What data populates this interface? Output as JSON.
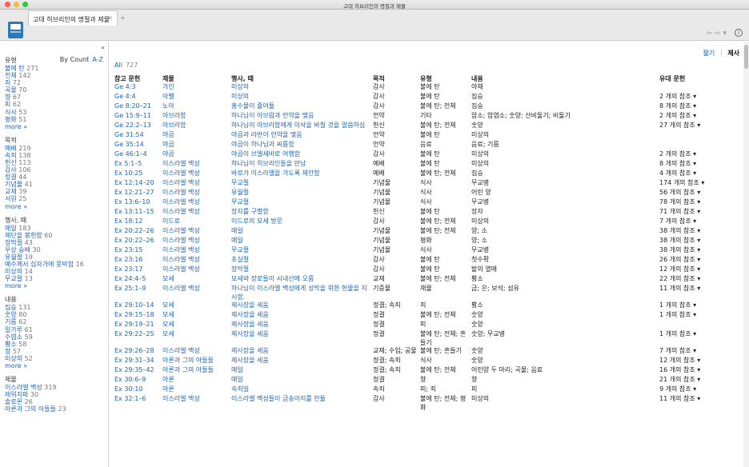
{
  "window": {
    "title": "고대 히브리인의 명절과 제물"
  },
  "tab": {
    "label": "고대 히브리인의 명절과 제물",
    "close": "×",
    "add": "+"
  },
  "toolbar": {
    "arrows": "⇦ ⇨ ▾",
    "help": "i"
  },
  "sidebar": {
    "collapse": "«",
    "sections": [
      {
        "title": "유형",
        "sort_by_count": "By Count",
        "sort_az": "A-Z",
        "items": [
          [
            "불에 탄",
            "271"
          ],
          [
            "전체",
            "142"
          ],
          [
            "죄",
            "72"
          ],
          [
            "곡물",
            "70"
          ],
          [
            "향",
            "67"
          ],
          [
            "피",
            "62"
          ],
          [
            "식사",
            "53"
          ],
          [
            "평화",
            "51"
          ]
        ],
        "more": "more »"
      },
      {
        "title": "목적",
        "items": [
          [
            "예배",
            "219"
          ],
          [
            "속죄",
            "138"
          ],
          [
            "헌신",
            "113"
          ],
          [
            "감사",
            "106"
          ],
          [
            "정결",
            "44"
          ],
          [
            "기념물",
            "41"
          ],
          [
            "교제",
            "39"
          ],
          [
            "서원",
            "25"
          ]
        ],
        "more": "more »"
      },
      {
        "title": "행사, 때",
        "items": [
          [
            "매일",
            "183"
          ],
          [
            "제단을 봉헌함",
            "60"
          ],
          [
            "장막절",
            "43"
          ],
          [
            "우상 숭배",
            "30"
          ],
          [
            "유월절",
            "19"
          ],
          [
            "예수께서 십자가에 못박힘",
            "16"
          ],
          [
            "미상의",
            "14"
          ],
          [
            "무교절",
            "13"
          ]
        ],
        "more": "more »"
      },
      {
        "title": "내용",
        "items": [
          [
            "짐승",
            "131"
          ],
          [
            "숫양",
            "80"
          ],
          [
            "기름",
            "62"
          ],
          [
            "밀가루",
            "61"
          ],
          [
            "수염소",
            "59"
          ],
          [
            "황소",
            "58"
          ],
          [
            "향",
            "57"
          ],
          [
            "미상의",
            "52"
          ]
        ],
        "more": "more »"
      },
      {
        "title": "제물",
        "items": [
          [
            "이스라엘 백성",
            "319"
          ],
          [
            "레위지파",
            "30"
          ],
          [
            "솔로몬",
            "26"
          ],
          [
            "아론과 그의 아들들",
            "23"
          ]
        ]
      }
    ]
  },
  "main": {
    "view_brief": "짧기",
    "view_offering": "제사",
    "all_label": "All",
    "all_count": "727",
    "headers": [
      "참고 문헌",
      "제물",
      "행사, 때",
      "목적",
      "유형",
      "내용",
      "유대 문헌"
    ],
    "rows": [
      [
        "Ge 4:3",
        "가인",
        "미상의",
        "감사",
        "불에 탄",
        "야채",
        ""
      ],
      [
        "Ge 4:4",
        "아벨",
        "미상의",
        "감사",
        "불에 탄",
        "짐승",
        "2 개의 참조 ▾"
      ],
      [
        "Ge 8:20–21",
        "노아",
        "홍수물이 줄어듦",
        "감사",
        "불에 탄; 전체",
        "짐승",
        "8 개의 참조 ▾"
      ],
      [
        "Ge 15:9–11",
        "아브라함",
        "하나님이 아브람과 언약을 맺음",
        "언약",
        "기타",
        "암소; 암염소; 숫양; 산비둘기; 비둘기",
        "2 개의 참조 ▾"
      ],
      [
        "Ge 22:2–13",
        "아브라함",
        "하나님이 아브라함에게 이삭을 바칠 것을 말씀하심",
        "헌신",
        "불에 탄; 전체",
        "숫양",
        "27 개의 참조 ▾"
      ],
      [
        "Ge 31:54",
        "야곱",
        "야곱과 라반이 언약을 맺음",
        "언약",
        "불에 탄",
        "미상의",
        ""
      ],
      [
        "Ge 35:14",
        "야곱",
        "야곱이 하나님과 씨름함",
        "언약",
        "음료",
        "음료; 기름",
        ""
      ],
      [
        "Ge 46:1–4",
        "야곱",
        "야곱이 브엘세바로 여행함",
        "감사",
        "불에 탄",
        "미상의",
        "2 개의 참조 ▾"
      ],
      [
        "Ex 5:1–5",
        "이스라엘 백성",
        "하나님이 히브리인들을 만남",
        "예배",
        "불에 탄",
        "미상의",
        "8 개의 참조 ▾"
      ],
      [
        "Ex 10:25",
        "이스라엘 백성",
        "바로가 이스라엘을 가도록 제안함",
        "예배",
        "불에 탄; 전체",
        "짐승",
        "4 개의 참조 ▾"
      ],
      [
        "Ex 12:14–20",
        "이스라엘 백성",
        "무교절",
        "기념물",
        "식사",
        "무교병",
        "174 개의 참조 ▾"
      ],
      [
        "Ex 12:21–27",
        "이스라엘 백성",
        "유월절",
        "기념물",
        "식사",
        "어린 양",
        "56 개의 참조 ▾"
      ],
      [
        "Ex 13:6–10",
        "이스라엘 백성",
        "무교절",
        "기념물",
        "식사",
        "무교병",
        "78 개의 참조 ▾"
      ],
      [
        "Ex 13:11–15",
        "이스라엘 백성",
        "장자를 구별함",
        "헌신",
        "불에 탄",
        "장자",
        "71 개의 참조 ▾"
      ],
      [
        "Ex 18:12",
        "이드로",
        "이드로의 모세 방문",
        "감사",
        "불에 탄; 전체",
        "미상의",
        "7 개의 참조 ▾"
      ],
      [
        "Ex 20:22–26",
        "이스라엘 백성",
        "매일",
        "기념물",
        "불에 탄; 전체",
        "양; 소",
        "38 개의 참조 ▾"
      ],
      [
        "Ex 20:22–26",
        "이스라엘 백성",
        "매일",
        "기념물",
        "평화",
        "양; 소",
        "38 개의 참조 ▾"
      ],
      [
        "Ex 23:15",
        "이스라엘 백성",
        "무교절",
        "기념물",
        "식사",
        "무교병",
        "38 개의 참조 ▾"
      ],
      [
        "Ex 23:16",
        "이스라엘 백성",
        "초실절",
        "감사",
        "불에 탄",
        "첫수확",
        "26 개의 참조 ▾"
      ],
      [
        "Ex 23:17",
        "이스라엘 백성",
        "장막절",
        "감사",
        "불에 탄",
        "밭의 열매",
        "12 개의 참조 ▾"
      ],
      [
        "Ex 24:4–5",
        "모세",
        "모세와 장로들이 시내산에 오름",
        "교제",
        "불에 탄; 전체",
        "황소",
        "22 개의 참조 ▾"
      ],
      [
        "Ex 25:1–9",
        "이스라엘 백성",
        "하나님이 이스라엘 백성에게 성막을 위한 헌물을 지시함.",
        "기증물",
        "재물",
        "금; 은; 보석; 섬유",
        "11 개의 참조 ▾"
      ],
      [
        "Ex 29:10–14",
        "모세",
        "제사장을 세움",
        "정결; 속죄",
        "죄",
        "황소",
        "1 개의 참조 ▾"
      ],
      [
        "Ex 29:15–18",
        "모세",
        "제사장을 세움",
        "정결",
        "불에 탄; 전체",
        "숫양",
        "1 개의 참조 ▾"
      ],
      [
        "Ex 29:19–21",
        "모세",
        "제사장을 세움",
        "정결",
        "피",
        "숫양",
        ""
      ],
      [
        "Ex 29:22–25",
        "모세",
        "제사장을 세움",
        "정결",
        "불에 탄; 전체; 흔들기",
        "숫양; 무교병",
        "1 개의 참조 ▾"
      ],
      [
        "Ex 29:26–28",
        "이스라엘 백성",
        "제사장을 세움",
        "교제; 수입; 공물",
        "불에 탄; 흔들기",
        "숫양",
        "7 개의 참조 ▾"
      ],
      [
        "Ex 29:31–34",
        "아론과 그의 아들들",
        "제사장을 세움",
        "정결; 속죄",
        "식사",
        "숫양",
        "12 개의 참조 ▾"
      ],
      [
        "Ex 29:35–42",
        "아론과 그의 아들들",
        "매일",
        "정결; 속죄",
        "불에 탄; 전체",
        "어린양 두 마리; 곡물; 음료",
        "16 개의 참조 ▾"
      ],
      [
        "Ex 30:6–9",
        "아론",
        "매일",
        "정결",
        "향",
        "향",
        "21 개의 참조 ▾"
      ],
      [
        "Ex 30:10",
        "아론",
        "속죄일",
        "속죄",
        "피; 죄",
        "피",
        "9 개의 참조 ▾"
      ],
      [
        "Ex 32:1–6",
        "이스라엘 백성",
        "이스라엘 백성들이 금송아지를 만듦",
        "감사",
        "불에 탄; 전체; 평화",
        "미상의",
        "11 개의 참조 ▾"
      ]
    ]
  }
}
